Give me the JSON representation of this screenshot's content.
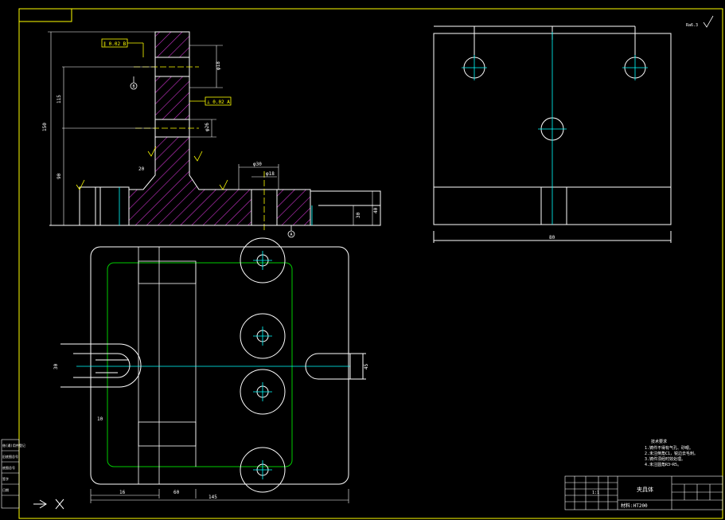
{
  "colors": {
    "background": "#000000",
    "line": "#ffffff",
    "dimension": "#ffffff",
    "border": "#ffff00",
    "centerline": "#00ffff",
    "hatch": "#cc33cc",
    "hidden": "#00cc00",
    "accent_yellow": "#ffff00"
  },
  "drawing": {
    "roughness_symbol": "Ra6.3",
    "dims": {
      "overall_height": "150",
      "upper_height": "115",
      "lower_height": "90",
      "bore_top": "φ18",
      "bore_mid": "φ26",
      "rib_width": "φ30",
      "step_depth": "20",
      "base_height": "30",
      "base_total": "40",
      "slot_width": "φ18",
      "slot_depth": "φ40",
      "base_width": "145",
      "left_offset": "16",
      "inner_span": "60",
      "slot_left_w": "30",
      "slot_right_w": "45",
      "small_r": "10",
      "right_view_width": "80"
    },
    "tolerance_frames": {
      "top": "∥ 0.02 B",
      "mid": "⊥ 0.02 A"
    },
    "datums": {
      "a": "A",
      "b": "B"
    },
    "notes": {
      "heading": "技术要求",
      "lines": [
        "1.铸件不得有气孔、砂眼。",
        "2.未注倒角C1，锐边去毛刺。",
        "3.铸件须经时效处理。",
        "4.未注圆角R3~R5。"
      ]
    },
    "title_block": {
      "name": "夹具体",
      "material": "材料:HT200",
      "scale": "1:1"
    },
    "left_stamps": [
      "借(通)用件登记",
      "旧底图总号",
      "底图总号",
      "签字",
      "日期"
    ]
  }
}
